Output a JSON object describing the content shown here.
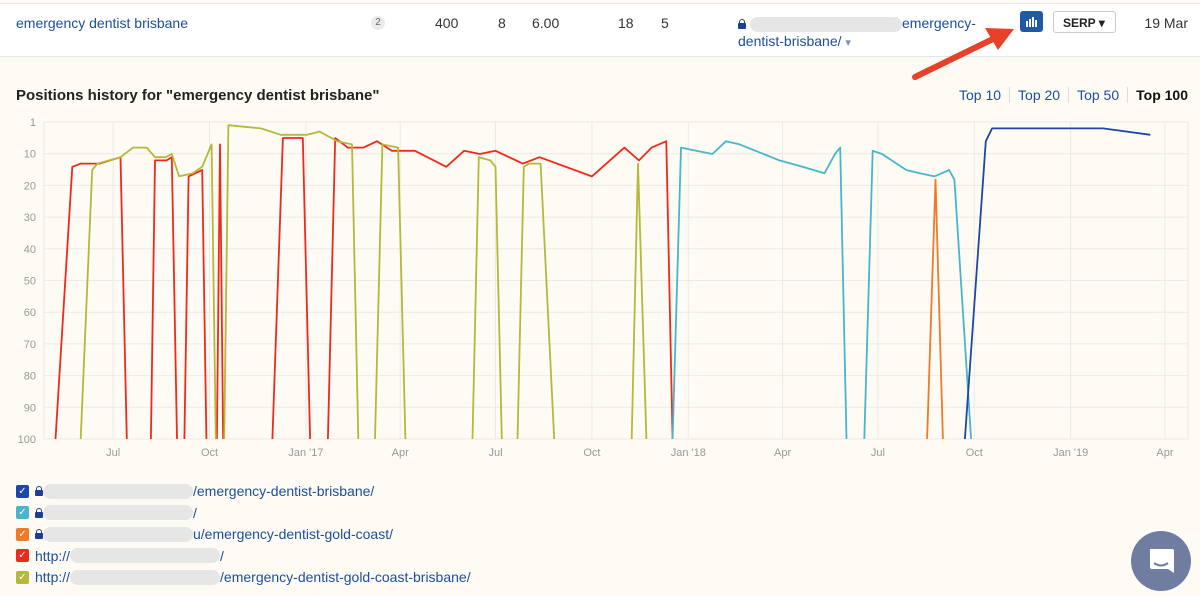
{
  "row": {
    "keyword": "emergency dentist brisbane",
    "badge": "2",
    "volume": "400",
    "kd": "8",
    "cpc": "6.00",
    "clicks": "18",
    "position": "5",
    "url_tail1": "emergency-",
    "url_tail2": "dentist-brisbane/",
    "url_caret": "▾",
    "serp_label": "SERP ▾",
    "date": "19 Mar",
    "chart_icon": "bar-chart-icon"
  },
  "section": {
    "title": "Positions history for \"emergency dentist brisbane\"",
    "tabs": [
      {
        "label": "Top 10"
      },
      {
        "label": "Top 20"
      },
      {
        "label": "Top 50"
      },
      {
        "label": "Top 100",
        "active": true
      }
    ]
  },
  "legend": [
    {
      "color": "#1c47a8",
      "lock": true,
      "text": "/emergency-dentist-brisbane/"
    },
    {
      "color": "#48b5cc",
      "lock": true,
      "text": "/"
    },
    {
      "color": "#ef7a2a",
      "lock": true,
      "text": "u/emergency-dentist-gold-coast/"
    },
    {
      "color": "#ee2a1c",
      "lock": false,
      "prefix": "http://",
      "text": "/"
    },
    {
      "color": "#b5b83a",
      "lock": false,
      "prefix": "http://",
      "text": "/emergency-dentist-gold-coast-brisbane/"
    }
  ],
  "chart_data": {
    "type": "line",
    "title": "Positions history for \"emergency dentist brisbane\"",
    "y_reversed": true,
    "ylim": [
      1,
      100
    ],
    "yticks": [
      "1",
      "10",
      "20",
      "30",
      "40",
      "50",
      "60",
      "70",
      "80",
      "90",
      "100"
    ],
    "xlim": [
      "2016-04-26",
      "2019-04-23"
    ],
    "xticks": [
      {
        "d": "2016-07-01",
        "l": "Jul"
      },
      {
        "d": "2016-10-01",
        "l": "Oct"
      },
      {
        "d": "2017-01-01",
        "l": "Jan '17"
      },
      {
        "d": "2017-04-01",
        "l": "Apr"
      },
      {
        "d": "2017-07-01",
        "l": "Jul"
      },
      {
        "d": "2017-10-01",
        "l": "Oct"
      },
      {
        "d": "2018-01-01",
        "l": "Jan '18"
      },
      {
        "d": "2018-04-01",
        "l": "Apr"
      },
      {
        "d": "2018-07-01",
        "l": "Jul"
      },
      {
        "d": "2018-10-01",
        "l": "Oct"
      },
      {
        "d": "2019-01-01",
        "l": "Jan '19"
      },
      {
        "d": "2019-04-01",
        "l": "Apr"
      }
    ],
    "grid": true,
    "series": [
      {
        "color": "#ee2a1c",
        "segments": [
          [
            [
              "2016-05-07",
              100
            ],
            [
              "2016-05-23",
              15
            ],
            [
              "2016-05-31",
              14
            ],
            [
              "2016-06-18",
              14
            ],
            [
              "2016-07-08",
              12
            ],
            [
              "2016-07-14",
              100
            ]
          ],
          [
            [
              "2016-08-06",
              100
            ],
            [
              "2016-08-10",
              13
            ],
            [
              "2016-08-21",
              13
            ],
            [
              "2016-08-26",
              12
            ],
            [
              "2016-08-31",
              100
            ]
          ],
          [
            [
              "2016-09-07",
              100
            ],
            [
              "2016-09-11",
              18
            ],
            [
              "2016-09-24",
              16
            ],
            [
              "2016-09-28",
              100
            ]
          ],
          [
            [
              "2016-10-08",
              100
            ],
            [
              "2016-10-11",
              8
            ],
            [
              "2016-10-14",
              100
            ]
          ],
          [
            [
              "2016-11-30",
              100
            ],
            [
              "2016-12-10",
              6
            ],
            [
              "2016-12-29",
              6
            ],
            [
              "2017-01-05",
              100
            ]
          ],
          [
            [
              "2017-01-22",
              100
            ],
            [
              "2017-01-29",
              6
            ],
            [
              "2017-02-10",
              9
            ],
            [
              "2017-02-25",
              9
            ],
            [
              "2017-03-10",
              7
            ],
            [
              "2017-03-24",
              10
            ],
            [
              "2017-04-15",
              10
            ],
            [
              "2017-05-15",
              15
            ],
            [
              "2017-06-01",
              10
            ],
            [
              "2017-06-16",
              11
            ],
            [
              "2017-07-01",
              10
            ],
            [
              "2017-07-27",
              14
            ],
            [
              "2017-08-12",
              12
            ],
            [
              "2017-10-01",
              18
            ],
            [
              "2017-11-01",
              9
            ],
            [
              "2017-11-15",
              13
            ],
            [
              "2017-11-27",
              9
            ],
            [
              "2017-12-11",
              7
            ],
            [
              "2017-12-17",
              100
            ]
          ]
        ]
      },
      {
        "color": "#b5b83a",
        "segments": [
          [
            [
              "2016-05-31",
              100
            ],
            [
              "2016-06-11",
              16
            ],
            [
              "2016-06-16",
              14
            ],
            [
              "2016-07-08",
              12
            ],
            [
              "2016-07-20",
              9
            ],
            [
              "2016-08-02",
              9
            ],
            [
              "2016-08-10",
              12
            ],
            [
              "2016-08-20",
              12
            ],
            [
              "2016-08-26",
              11
            ],
            [
              "2016-09-02",
              18
            ],
            [
              "2016-09-15",
              17
            ],
            [
              "2016-09-24",
              15
            ],
            [
              "2016-10-03",
              8
            ],
            [
              "2016-10-07",
              100
            ]
          ],
          [
            [
              "2016-10-15",
              100
            ],
            [
              "2016-10-19",
              2
            ],
            [
              "2016-11-19",
              3
            ],
            [
              "2016-12-08",
              5
            ],
            [
              "2017-01-02",
              5
            ],
            [
              "2017-01-14",
              4
            ],
            [
              "2017-01-31",
              7
            ],
            [
              "2017-02-14",
              8
            ],
            [
              "2017-02-20",
              100
            ]
          ],
          [
            [
              "2017-03-08",
              100
            ],
            [
              "2017-03-15",
              8
            ],
            [
              "2017-03-30",
              9
            ],
            [
              "2017-04-06",
              100
            ]
          ],
          [
            [
              "2017-06-09",
              100
            ],
            [
              "2017-06-15",
              12
            ],
            [
              "2017-06-26",
              13
            ],
            [
              "2017-07-01",
              15
            ],
            [
              "2017-07-07",
              100
            ]
          ],
          [
            [
              "2017-07-22",
              100
            ],
            [
              "2017-07-28",
              15
            ],
            [
              "2017-08-02",
              14
            ],
            [
              "2017-08-13",
              14
            ],
            [
              "2017-08-26",
              100
            ]
          ],
          [
            [
              "2017-11-08",
              100
            ],
            [
              "2017-11-14",
              14
            ],
            [
              "2017-11-22",
              100
            ]
          ]
        ]
      },
      {
        "color": "#48b5cc",
        "segments": [
          [
            [
              "2017-12-17",
              100
            ],
            [
              "2017-12-25",
              9
            ],
            [
              "2018-01-24",
              11
            ],
            [
              "2018-02-06",
              7
            ],
            [
              "2018-02-19",
              8
            ],
            [
              "2018-03-29",
              13
            ],
            [
              "2018-04-20",
              15
            ],
            [
              "2018-05-11",
              17
            ],
            [
              "2018-05-21",
              11
            ],
            [
              "2018-05-26",
              9
            ],
            [
              "2018-06-01",
              100
            ]
          ],
          [
            [
              "2018-06-18",
              100
            ],
            [
              "2018-06-26",
              10
            ],
            [
              "2018-07-05",
              11
            ],
            [
              "2018-07-28",
              16
            ],
            [
              "2018-08-10",
              17
            ],
            [
              "2018-08-24",
              18
            ],
            [
              "2018-09-07",
              16
            ],
            [
              "2018-09-12",
              19
            ],
            [
              "2018-09-28",
              100
            ]
          ]
        ]
      },
      {
        "color": "#ef7a2a",
        "segments": [
          [
            [
              "2018-08-17",
              100
            ],
            [
              "2018-08-25",
              19
            ],
            [
              "2018-09-01",
              100
            ]
          ]
        ]
      },
      {
        "color": "#1c47a8",
        "segments": [
          [
            [
              "2018-09-22",
              100
            ],
            [
              "2018-10-12",
              7
            ],
            [
              "2018-10-18",
              3
            ],
            [
              "2019-01-19",
              3
            ],
            [
              "2019-02-01",
              3
            ],
            [
              "2019-03-18",
              5
            ]
          ]
        ]
      }
    ]
  }
}
